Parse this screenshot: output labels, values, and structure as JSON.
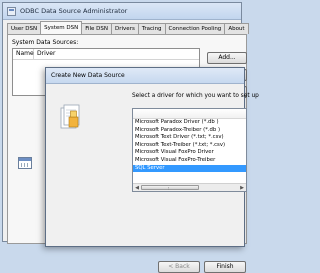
{
  "main_window": {
    "title": "ODBC Data Source Administrator",
    "tabs": [
      "User DSN",
      "System DSN",
      "File DSN",
      "Drivers",
      "Tracing",
      "Connection Pooling",
      "About"
    ],
    "active_tab": "System DSN",
    "system_data_sources_label": "System Data Sources:",
    "columns": [
      "Name",
      "Driver"
    ],
    "add_button": "Add..."
  },
  "dialog": {
    "title": "Create New Data Source",
    "prompt": "Select a driver for which you want to set up",
    "drivers": [
      "Microsoft Paradox Driver (*.db )",
      "Microsoft Paradox-Treiber (*.db )",
      "Microsoft Text Driver (*.txt; *.csv)",
      "Microsoft Text-Treiber (*.txt; *.csv)",
      "Microsoft Visual FoxPro Driver",
      "Microsoft Visual FoxPro-Treiber",
      "SQL Server"
    ],
    "selected_driver": "SQL Server",
    "back_button": "< Back",
    "finish_button": "Finish"
  },
  "colors": {
    "selection": "#3399ff",
    "title_gradient_top": "#dbe7f6",
    "desktop": "#c9d9ec"
  }
}
